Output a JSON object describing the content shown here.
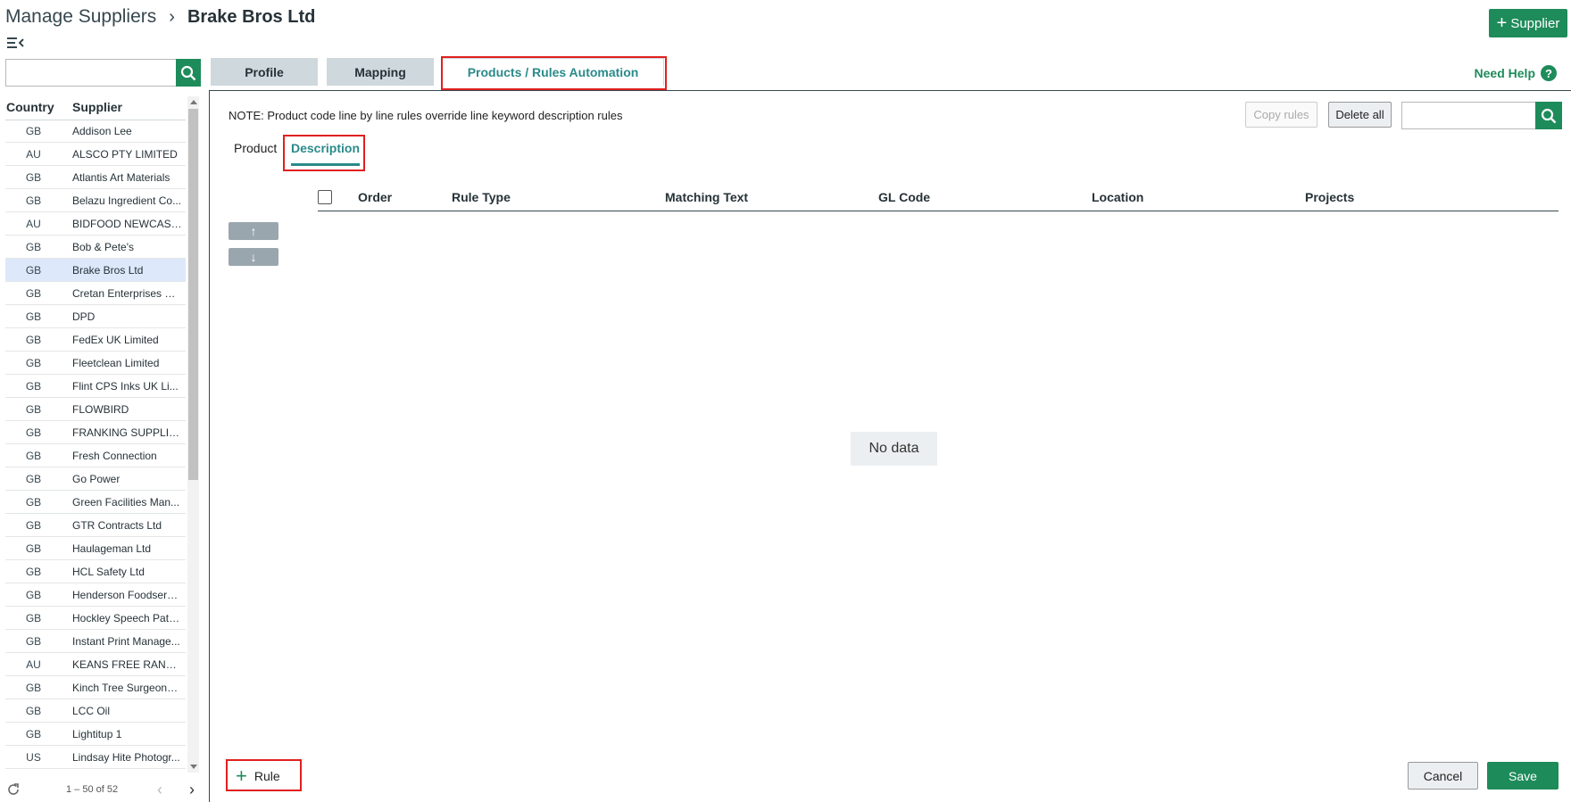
{
  "breadcrumb": {
    "parent": "Manage Suppliers",
    "separator": "›",
    "current": "Brake Bros Ltd"
  },
  "header": {
    "add_supplier_label": "Supplier"
  },
  "left_panel": {
    "search_value": "",
    "columns": {
      "country": "Country",
      "supplier": "Supplier"
    },
    "suppliers": [
      {
        "country": "GB",
        "name": "Addison Lee"
      },
      {
        "country": "AU",
        "name": "ALSCO PTY LIMITED"
      },
      {
        "country": "GB",
        "name": "Atlantis Art Materials"
      },
      {
        "country": "GB",
        "name": "Belazu Ingredient Co..."
      },
      {
        "country": "AU",
        "name": "BIDFOOD NEWCASTLE"
      },
      {
        "country": "GB",
        "name": "Bob & Pete's"
      },
      {
        "country": "GB",
        "name": "Brake Bros Ltd"
      },
      {
        "country": "GB",
        "name": "Cretan Enterprises P/..."
      },
      {
        "country": "GB",
        "name": "DPD"
      },
      {
        "country": "GB",
        "name": "FedEx UK Limited"
      },
      {
        "country": "GB",
        "name": "Fleetclean Limited"
      },
      {
        "country": "GB",
        "name": "Flint CPS Inks UK Li..."
      },
      {
        "country": "GB",
        "name": "FLOWBIRD"
      },
      {
        "country": "GB",
        "name": "FRANKING SUPPLIE..."
      },
      {
        "country": "GB",
        "name": "Fresh Connection"
      },
      {
        "country": "GB",
        "name": "Go Power"
      },
      {
        "country": "GB",
        "name": "Green Facilities Man..."
      },
      {
        "country": "GB",
        "name": "GTR Contracts Ltd"
      },
      {
        "country": "GB",
        "name": "Haulageman Ltd"
      },
      {
        "country": "GB",
        "name": "HCL Safety Ltd"
      },
      {
        "country": "GB",
        "name": "Henderson Foodservi..."
      },
      {
        "country": "GB",
        "name": "Hockley Speech Path..."
      },
      {
        "country": "GB",
        "name": "Instant Print Manage..."
      },
      {
        "country": "AU",
        "name": "KEANS FREE RANGE ..."
      },
      {
        "country": "GB",
        "name": "Kinch Tree Surgeons ..."
      },
      {
        "country": "GB",
        "name": "LCC Oil"
      },
      {
        "country": "GB",
        "name": "Lightitup 1"
      },
      {
        "country": "US",
        "name": "Lindsay Hite Photogr..."
      }
    ],
    "selected_index": 6,
    "pager": {
      "range": "1 – 50 of 52",
      "prev": "‹",
      "next": "›"
    }
  },
  "tabs": {
    "profile": "Profile",
    "mapping": "Mapping",
    "products": "Products / Rules Automation"
  },
  "need_help": {
    "label": "Need Help",
    "icon": "?"
  },
  "content": {
    "note": "NOTE: Product code line by line rules override line keyword description rules",
    "copy_rules": "Copy rules",
    "delete_all": "Delete all",
    "search_value": "",
    "subtabs": {
      "product": "Product",
      "description": "Description"
    },
    "grid_columns": {
      "order": "Order",
      "rule_type": "Rule Type",
      "matching_text": "Matching Text",
      "gl_code": "GL Code",
      "location": "Location",
      "projects": "Projects"
    },
    "move_up": "↑",
    "move_down": "↓",
    "no_data": "No data",
    "add_rule": "Rule",
    "cancel": "Cancel",
    "save": "Save"
  },
  "colors": {
    "accent_green": "#1e8b5a",
    "teal": "#2b8a8a",
    "highlight_red": "#e0201f",
    "selected_row": "#dde8fa"
  }
}
